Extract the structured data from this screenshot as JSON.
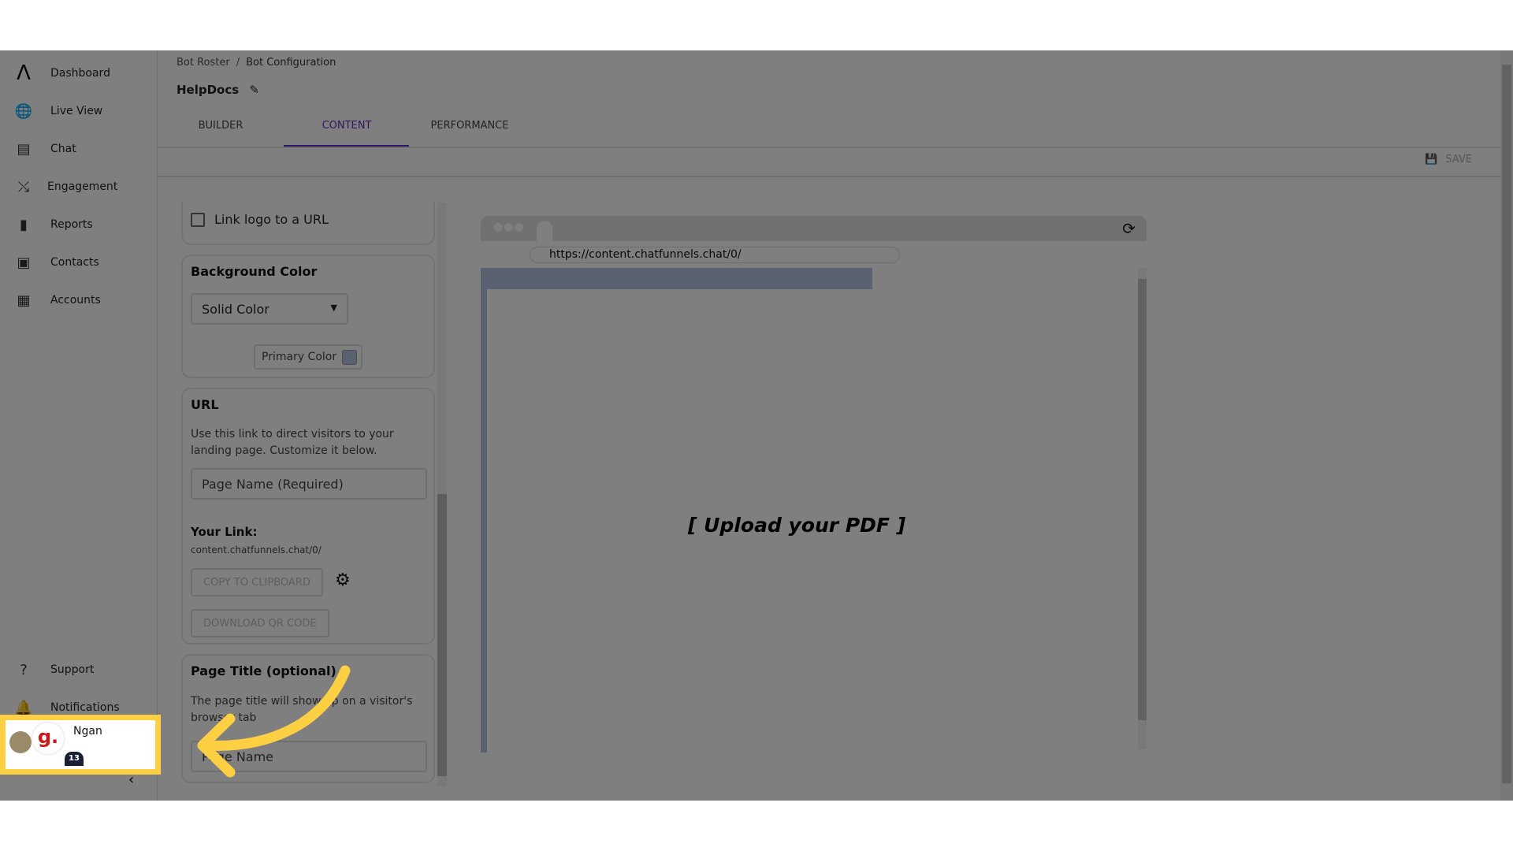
{
  "sidebar": {
    "items": [
      {
        "label": "Dashboard",
        "icon": "logo-icon"
      },
      {
        "label": "Live View",
        "icon": "globe-search-icon"
      },
      {
        "label": "Chat",
        "icon": "chat-icon"
      },
      {
        "label": "Engagement",
        "icon": "strategy-icon"
      },
      {
        "label": "Reports",
        "icon": "bar-chart-icon"
      },
      {
        "label": "Contacts",
        "icon": "contacts-icon"
      },
      {
        "label": "Accounts",
        "icon": "building-icon"
      }
    ],
    "bottom": [
      {
        "label": "Support",
        "icon": "help-icon"
      },
      {
        "label": "Notifications",
        "icon": "bell-icon"
      }
    ],
    "user": {
      "name": "Ngan",
      "badge": "13",
      "logo_letter": "g."
    }
  },
  "breadcrumb": {
    "parent": "Bot Roster",
    "current": "Bot Configuration"
  },
  "bot_name": "HelpDocs",
  "tabs": [
    {
      "label": "BUILDER"
    },
    {
      "label": "CONTENT",
      "active": true
    },
    {
      "label": "PERFORMANCE"
    }
  ],
  "toolbar": {
    "save_label": "SAVE"
  },
  "panel": {
    "link_logo_label": "Link logo to a URL",
    "background": {
      "title": "Background Color",
      "select_value": "Solid Color",
      "primary_color_label": "Primary Color"
    },
    "url": {
      "title": "URL",
      "description": "Use this link to direct visitors to your landing page. Customize it below.",
      "placeholder": "Page Name (Required)",
      "your_link_label": "Your Link:",
      "link": "content.chatfunnels.chat/0/",
      "copy_label": "COPY TO CLIPBOARD",
      "qr_label": "DOWNLOAD QR CODE"
    },
    "page_title": {
      "title": "Page Title (optional)",
      "description": "The page title will show up on a visitor's browser tab",
      "placeholder": "Page Name"
    }
  },
  "preview": {
    "url": "https://content.chatfunnels.chat/0/",
    "placeholder": "[ Upload your PDF ]"
  },
  "colors": {
    "accent": "#6a2bc4",
    "highlight": "#fdd044",
    "banner": "#b4c2e0"
  }
}
